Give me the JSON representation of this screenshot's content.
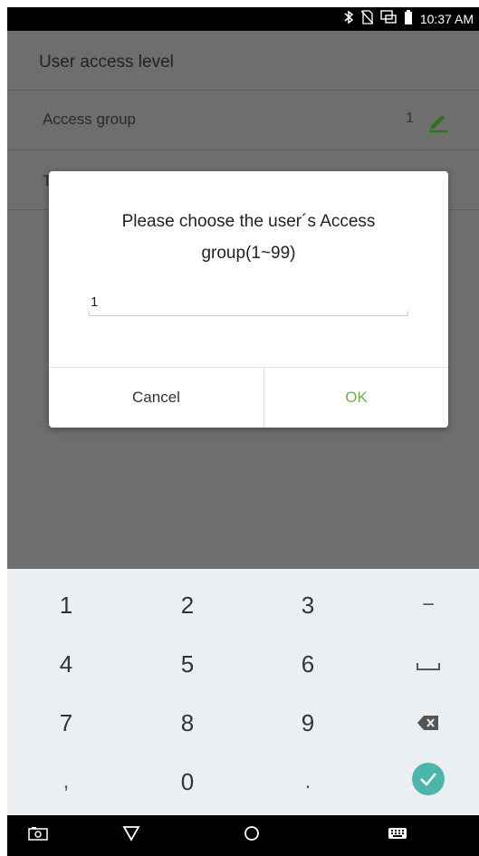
{
  "status_bar": {
    "time": "10:37 AM",
    "icons": [
      "bluetooth-icon",
      "no-sim-icon",
      "screen-cast-icon",
      "battery-icon"
    ]
  },
  "screen": {
    "title": "User access level",
    "rows": [
      {
        "label": "Access group",
        "value": "1",
        "icon": "pencil-edit-icon"
      },
      {
        "label": "T",
        "value": ""
      }
    ]
  },
  "dialog": {
    "message": "Please choose the user´s Access group(1~99)",
    "input_value": "1",
    "cancel_label": "Cancel",
    "ok_label": "OK",
    "ok_color": "#6ab04c"
  },
  "keyboard": {
    "keys": [
      [
        "1",
        "2",
        "3",
        "−"
      ],
      [
        "4",
        "5",
        "6",
        "space"
      ],
      [
        "7",
        "8",
        "9",
        "backspace"
      ],
      [
        ",",
        "0",
        ".",
        "done"
      ]
    ],
    "done_color": "#4db6ac"
  },
  "nav_bar": {
    "buttons": [
      "screenshot-icon",
      "back-icon",
      "home-icon",
      "keyboard-icon"
    ]
  }
}
